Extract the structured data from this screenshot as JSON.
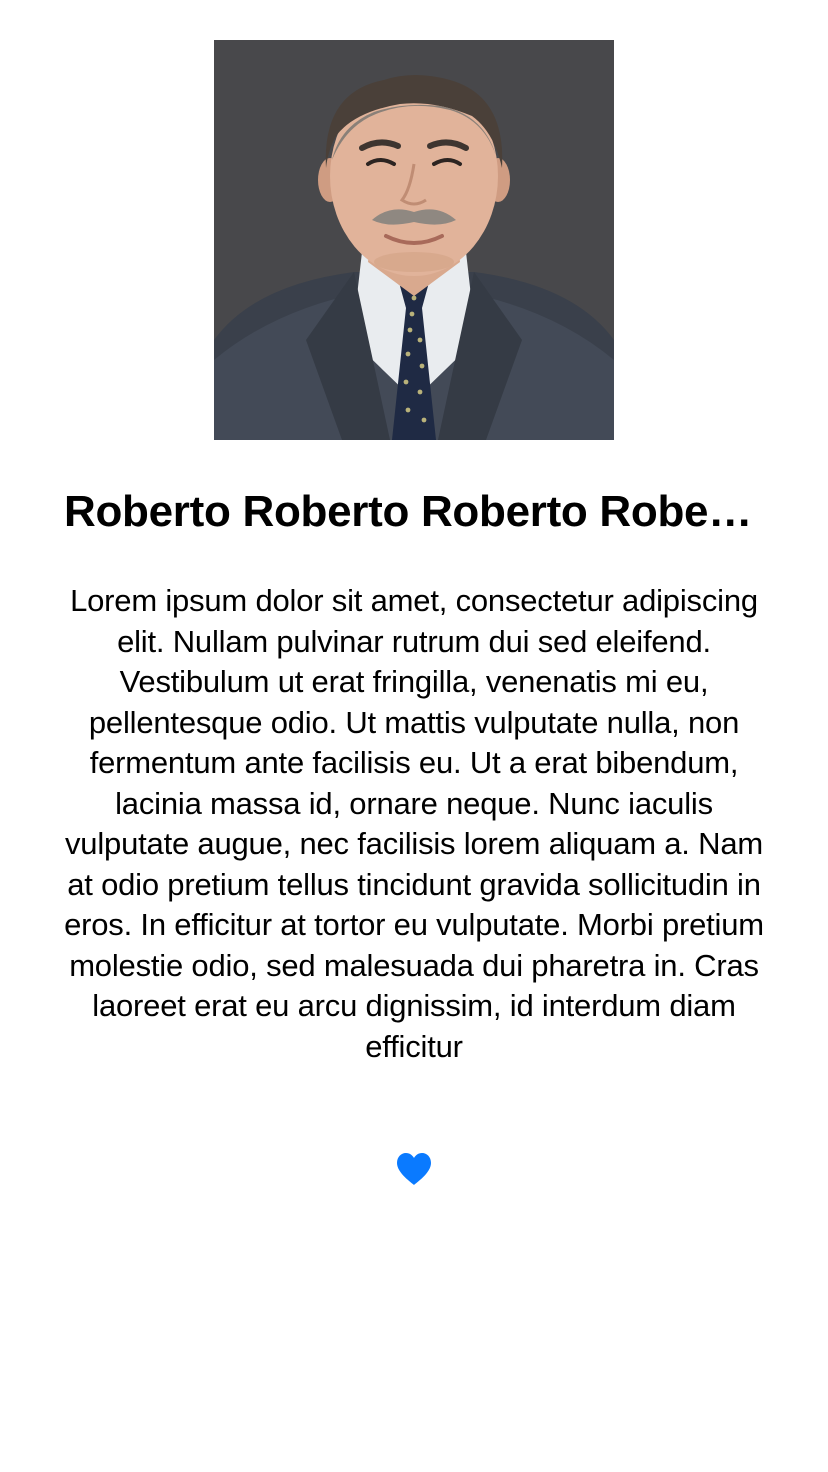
{
  "profile": {
    "name": "Roberto Roberto Roberto Roberto",
    "bio": "Lorem ipsum dolor sit amet, consectetur adipiscing elit. Nullam pulvinar rutrum dui sed eleifend. Vestibulum ut erat fringilla, venenatis mi eu, pellentesque odio. Ut mattis vulputate nulla, non fermentum ante facilisis eu. Ut a erat bibendum, lacinia massa id, ornare neque. Nunc iaculis vulputate augue, nec facilisis lorem aliquam a. Nam at odio pretium tellus tincidunt gravida sollicitudin in eros. In efficitur at tortor eu vulputate. Morbi pretium molestie odio, sed malesuada dui pharetra in. Cras laoreet erat eu arcu dignissim, id interdum diam efficitur",
    "photo_icon": "person-portrait",
    "favorite_icon": "heart-icon",
    "favorited": true
  },
  "colors": {
    "background": "#ffffff",
    "text": "#000000",
    "accent": "#0a7aff"
  }
}
